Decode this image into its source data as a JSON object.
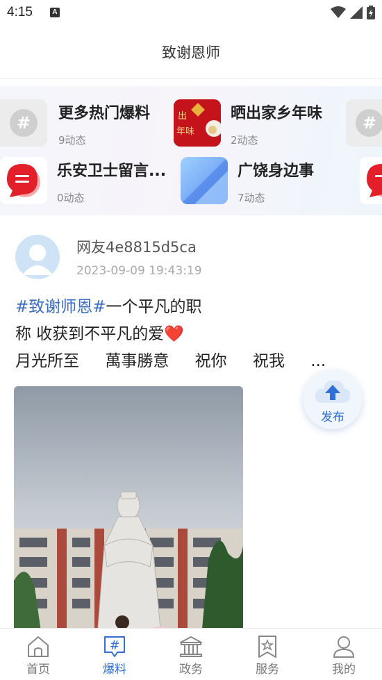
{
  "status_bar": {
    "time": "4:15",
    "notification_icon": "a-icon"
  },
  "header": {
    "title": "致谢恩师"
  },
  "topics": [
    {
      "title": "更多热门爆料",
      "count": "9动态",
      "thumb": "hash-bubble-icon"
    },
    {
      "title": "晒出家乡年味",
      "count": "2动态",
      "thumb": "new-year-image"
    },
    {
      "title": "乐安卫士留言...",
      "count": "0动态",
      "thumb": "red-chat-icon"
    },
    {
      "title": "广饶身边事",
      "count": "7动态",
      "thumb": "blue-tile-image"
    }
  ],
  "post": {
    "username": "网友4e8815d5ca",
    "timestamp": "2023-09-09  19:43:19",
    "hashtag": "#致谢师恩#",
    "line1_rest": "一个平凡的职",
    "line2": "称  收获到不平凡的爱",
    "heart": "❤️",
    "line3": [
      "月光所至",
      "萬事勝意",
      "祝你",
      "祝我",
      "..."
    ],
    "thumb_labels": [
      "出",
      "年味"
    ]
  },
  "publish_button": {
    "label": "发布"
  },
  "bottom_nav": [
    {
      "label": "首页",
      "icon": "home-icon",
      "active": false
    },
    {
      "label": "爆料",
      "icon": "hashtag-chat-icon",
      "active": true
    },
    {
      "label": "政务",
      "icon": "government-building-icon",
      "active": false
    },
    {
      "label": "服务",
      "icon": "star-bookmark-icon",
      "active": false
    },
    {
      "label": "我的",
      "icon": "user-icon",
      "active": false
    }
  ],
  "colors": {
    "accent": "#2f6fd6",
    "hashtag": "#3a6ec4",
    "heart": "#d4151c"
  }
}
